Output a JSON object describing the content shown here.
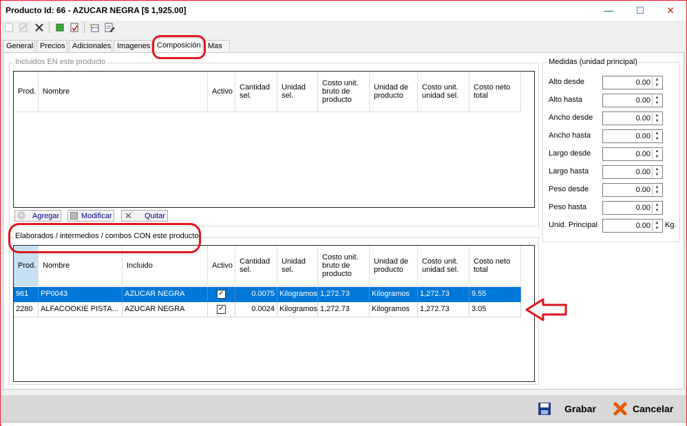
{
  "window": {
    "title": "Producto Id: 66 - AZUCAR NEGRA [$ 1,925.00]",
    "minimize": "—",
    "maximize": "☐",
    "close": "✕"
  },
  "tabs": [
    "General",
    "Precios",
    "Adicionales",
    "Imagenes",
    "Composición",
    "Mas"
  ],
  "incluidos": {
    "legend": "Incluidos  EN este producto",
    "headers": [
      "Prod.",
      "Nombre",
      "Activo",
      "Cantidad sel.",
      "Unidad sel.",
      "Costo unit. bruto de producto",
      "Unidad de producto",
      "Costo unit. unidad sel.",
      "Costo neto total"
    ]
  },
  "actions": {
    "agregar": "Agregar",
    "modificar": "Modificar",
    "quitar": "Quitar"
  },
  "elaborados": {
    "legend": "Elaborados / intermedios / combos CON este producto",
    "headers": [
      "Prod.",
      "Nombre",
      "Incluido",
      "Activo",
      "Cantidad sel.",
      "Unidad sel.",
      "Costo unit. bruto de producto",
      "Unidad de producto",
      "Costo unit. unidad sel.",
      "Costo neto total"
    ],
    "rows": [
      {
        "prod": "961",
        "nombre": "PP0043",
        "incluido": "AZUCAR NEGRA",
        "activo": "✓",
        "cantidad": "0.0075",
        "unidad": "Kilogramos",
        "costo_bruto": "1,272.73",
        "unidad_producto": "Kilogramos",
        "costo_unidad": "1,272.73",
        "neto": "9.55"
      },
      {
        "prod": "2280",
        "nombre": "ALFACOOKIE PISTA...",
        "incluido": "AZUCAR NEGRA",
        "activo": "✓",
        "cantidad": "0.0024",
        "unidad": "Kilogramos",
        "costo_bruto": "1,272.73",
        "unidad_producto": "Kilogramos",
        "costo_unidad": "1,272.73",
        "neto": "3.05"
      }
    ]
  },
  "medidas": {
    "legend": "Medidas (unidad principal)",
    "fields": [
      {
        "label": "Alto desde",
        "value": "0.00"
      },
      {
        "label": "Alto hasta",
        "value": "0.00"
      },
      {
        "label": "Ancho desde",
        "value": "0.00"
      },
      {
        "label": "Ancho hasta",
        "value": "0.00"
      },
      {
        "label": "Largo desde",
        "value": "0.00"
      },
      {
        "label": "Largo hasta",
        "value": "0.00"
      },
      {
        "label": "Peso desde",
        "value": "0.00"
      },
      {
        "label": "Peso hasta",
        "value": "0.00"
      },
      {
        "label": "Unid. Principal",
        "value": "0.00"
      }
    ],
    "unit_suffix": "Kg."
  },
  "footer": {
    "grabar": "Grabar",
    "cancelar": "Cancelar"
  },
  "colors": {
    "selection": "#0078d7",
    "highlight": "#e0141e",
    "link": "#00008b"
  }
}
